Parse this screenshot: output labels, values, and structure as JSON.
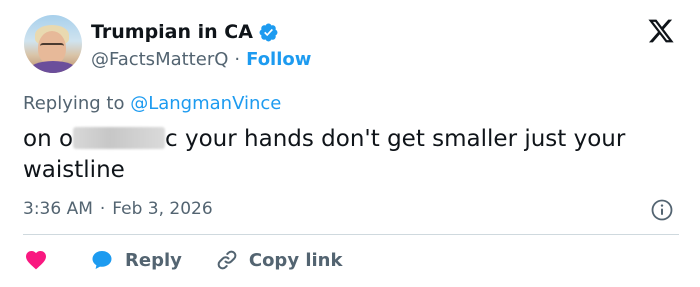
{
  "author": {
    "display_name": "Trumpian in CA",
    "handle": "@FactsMatterQ",
    "separator": "·",
    "follow_label": "Follow"
  },
  "reply_context": {
    "prefix": "Replying to",
    "mention": "@LangmanVince"
  },
  "tweet": {
    "text_start": "on o",
    "text_end": "c your hands don't get smaller just your waistline"
  },
  "meta": {
    "time": "3:36 AM",
    "separator": "·",
    "date": "Feb 3, 2026"
  },
  "actions": {
    "reply_label": "Reply",
    "copy_link_label": "Copy link"
  },
  "colors": {
    "accent": "#1d9bf0",
    "like": "#f91880",
    "text": "#0f1419",
    "muted": "#536471"
  },
  "icons": [
    "verified-badge-icon",
    "x-logo-icon",
    "info-icon",
    "heart-icon",
    "reply-bubble-icon",
    "link-icon"
  ]
}
